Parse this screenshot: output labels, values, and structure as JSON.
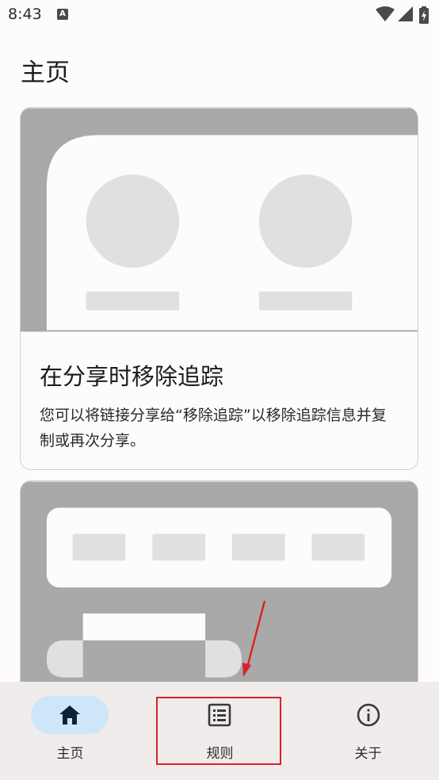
{
  "status_bar": {
    "time": "8:43",
    "notification_glyph": "A"
  },
  "page": {
    "title": "主页"
  },
  "cards": [
    {
      "heading": "在分享时移除追踪",
      "body": "您可以将链接分享给“移除追踪”以移除追踪信息并复制或再次分享。"
    },
    {}
  ],
  "bottom_nav": {
    "items": [
      {
        "label": "主页",
        "icon": "home-icon",
        "selected": true
      },
      {
        "label": "规则",
        "icon": "list-icon",
        "selected": false
      },
      {
        "label": "关于",
        "icon": "info-icon",
        "selected": false
      }
    ]
  },
  "colors": {
    "accent_pill": "#cde6f8",
    "icon_dark": "#0d2236",
    "annotation_red": "#d92226",
    "illustration_gray": "#a9a9a9",
    "placeholder_gray": "#e0e1df"
  }
}
